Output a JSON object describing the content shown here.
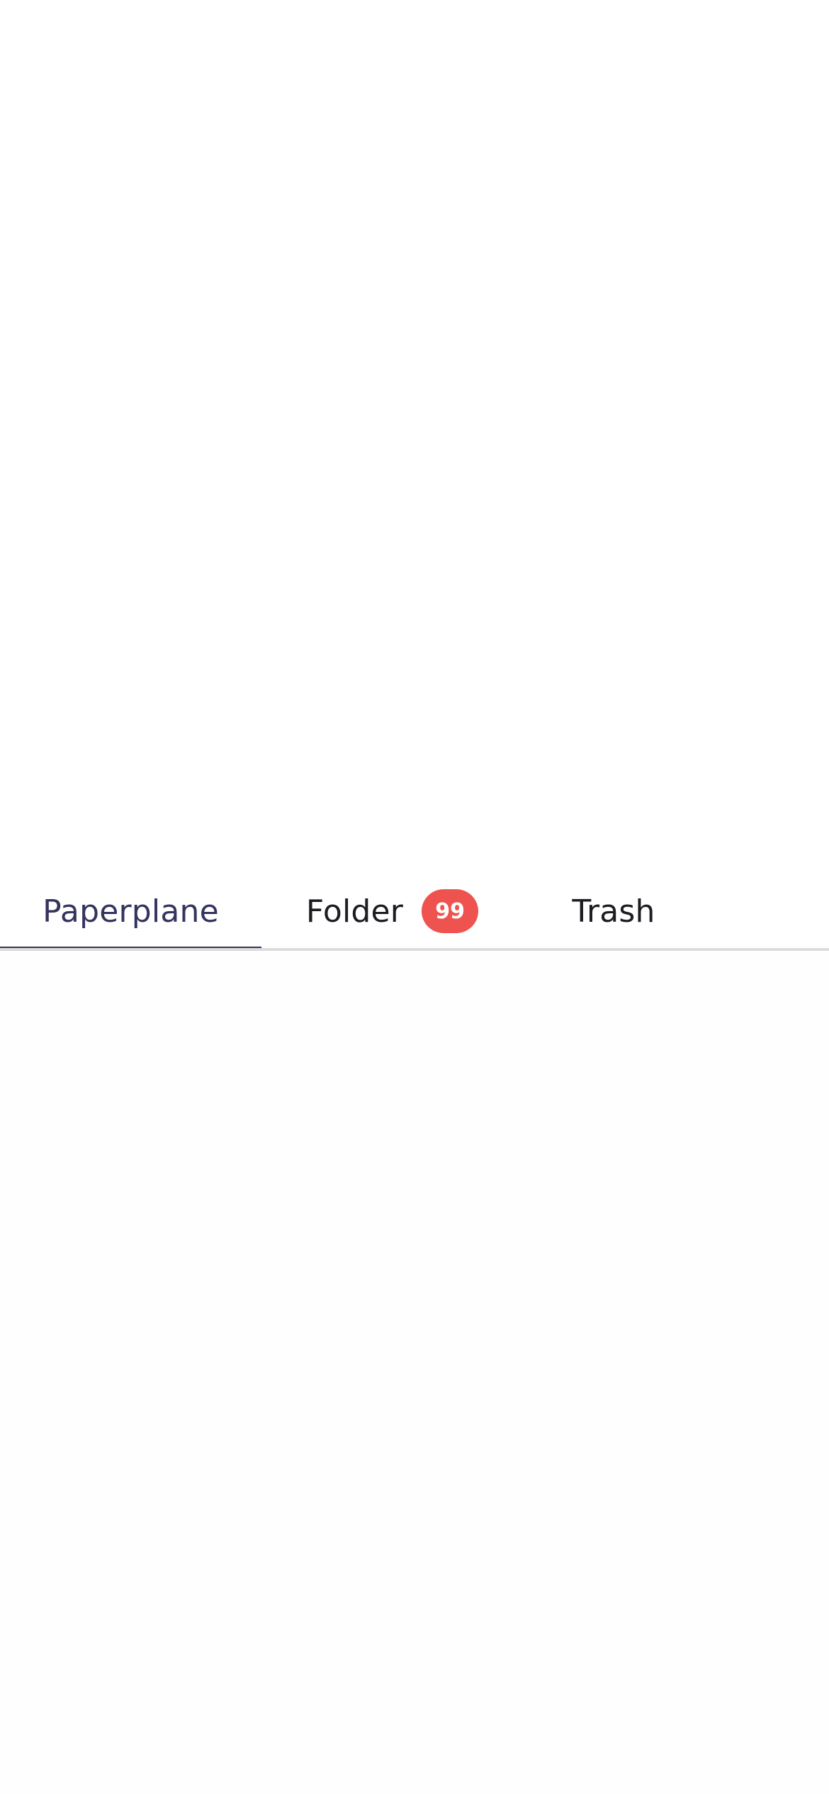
{
  "tabs": [
    {
      "label": "Paperplane",
      "active": true
    },
    {
      "label": "Folder",
      "badge": "99",
      "active": false
    },
    {
      "label": "Trash",
      "active": false
    }
  ],
  "colors": {
    "active_tab": "#34345e",
    "tab_text": "#1c1c22",
    "badge_bg": "#ef5350",
    "divider": "#dcdcdc"
  }
}
